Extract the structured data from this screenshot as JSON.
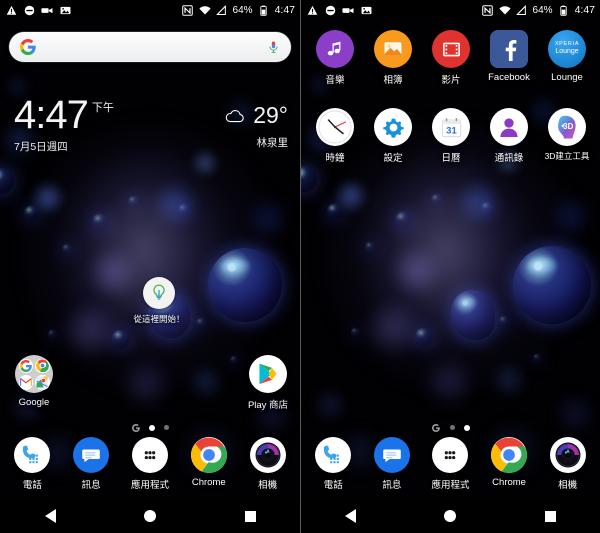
{
  "status_bar": {
    "left_icons": [
      "warning-icon",
      "do-not-disturb-icon",
      "video-camera-icon",
      "screenshot-icon"
    ],
    "right_icons": [
      "nfc-icon",
      "wifi-icon",
      "signal-icon"
    ],
    "battery_percent": "64%",
    "clock": "4:47"
  },
  "search": {
    "placeholder": "",
    "value": "",
    "google_icon": "google-g-icon",
    "mic_icon": "microphone-icon"
  },
  "clock_widget": {
    "time": "4:47",
    "ampm": "下午",
    "date": "7月5日週四",
    "weather_icon": "cloud-icon",
    "temperature": "29°",
    "location": "林泉里"
  },
  "shortcut": {
    "label": "從這裡開始！",
    "icon": "lightbulb-icon"
  },
  "home_page_1": {
    "folder": {
      "label": "Google",
      "icons": [
        "google-icon",
        "chrome-icon",
        "gmail-icon",
        "maps-icon"
      ]
    },
    "play_store": {
      "label": "Play 商店",
      "icon": "play-store-icon"
    }
  },
  "home_page_2": {
    "rows": [
      [
        {
          "label": "音樂",
          "icon": "music-note-icon",
          "color": "#8b3ec7",
          "shape": "circle"
        },
        {
          "label": "相簿",
          "icon": "photo-album-icon",
          "color": "#f79a1e",
          "shape": "circle"
        },
        {
          "label": "影片",
          "icon": "film-strip-icon",
          "color": "#e0332f",
          "shape": "circle"
        },
        {
          "label": "Facebook",
          "icon": "facebook-icon",
          "color": "#3b5998",
          "shape": "rounded-square"
        },
        {
          "label": "Lounge",
          "icon": "xperia-lounge-icon",
          "color": "#0f8ee0",
          "shape": "circle"
        }
      ],
      [
        {
          "label": "時鐘",
          "icon": "clock-icon",
          "color": "#ffffff",
          "shape": "circle"
        },
        {
          "label": "設定",
          "icon": "gear-icon",
          "color": "#ffffff",
          "shape": "circle"
        },
        {
          "label": "日曆",
          "icon": "calendar-icon",
          "color": "#ffffff",
          "shape": "circle"
        },
        {
          "label": "通訊錄",
          "icon": "contacts-person-icon",
          "color": "#ffffff",
          "shape": "circle"
        },
        {
          "label": "3D建立工具",
          "icon": "3d-creator-head-icon",
          "color": "#ffffff",
          "shape": "circle"
        }
      ]
    ],
    "lounge_text_top": "XPERIA",
    "lounge_text_bottom": "Lounge",
    "calendar_day": "31",
    "creator_3d_text": "3D"
  },
  "page_indicator": {
    "left_screen_active_index": 1,
    "right_screen_active_index": 2,
    "dots": [
      "google-feed-dot",
      "dot",
      "dot"
    ]
  },
  "dock": [
    {
      "label": "電話",
      "icon": "phone-dialpad-icon"
    },
    {
      "label": "訊息",
      "icon": "messages-bubble-icon"
    },
    {
      "label": "應用程式",
      "icon": "app-drawer-icon"
    },
    {
      "label": "Chrome",
      "icon": "chrome-icon"
    },
    {
      "label": "相機",
      "icon": "camera-lens-icon"
    }
  ],
  "nav_bar": [
    {
      "name": "back",
      "icon": "back-triangle-icon"
    },
    {
      "name": "home",
      "icon": "home-circle-icon"
    },
    {
      "name": "recents",
      "icon": "recents-square-icon"
    }
  ],
  "colors": {
    "wallpaper_base": "#010103",
    "bubble_blue": "#3c5adc",
    "accent_cyan": "#57e8ff",
    "purple_haze": "#8f86d8"
  }
}
